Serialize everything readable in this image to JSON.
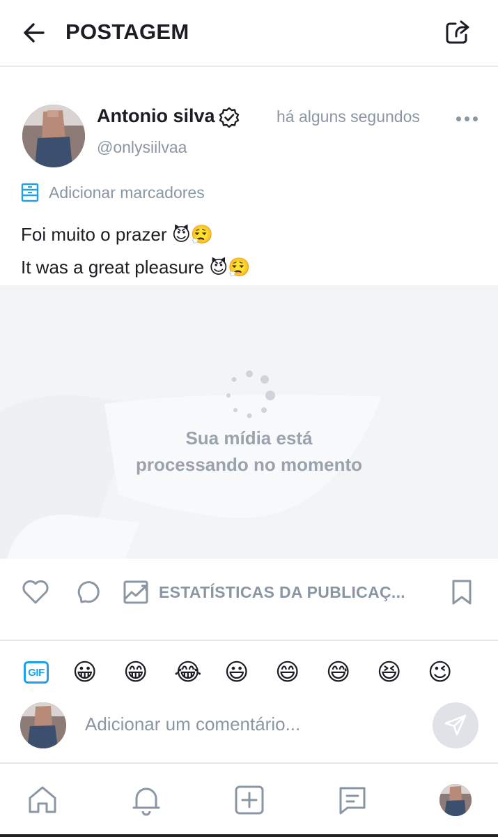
{
  "header": {
    "title": "POSTAGEM",
    "back_icon": "arrow-left-icon",
    "share_icon": "share-icon"
  },
  "post": {
    "author_name": "Antonio silva",
    "handle": "@onlysiilvaa",
    "time": "há alguns segundos",
    "bookmark_label": "Adicionar marcadores",
    "text_line1": "Foi muito o prazer",
    "text_line1_emoji": "😈😮‍💨",
    "text_line2": "It was a great pleasure",
    "text_line2_emoji": "😈😮‍💨"
  },
  "media": {
    "message_line1": "Sua mídia está",
    "message_line2": "processando no momento"
  },
  "actions": {
    "stats_label": "ESTATÍSTICAS DA PUBLICAÇ..."
  },
  "emoji_bar": {
    "gif_label": "GIF",
    "emojis": [
      "😀",
      "😁",
      "😂",
      "😃",
      "😄",
      "😅",
      "😆",
      "😉"
    ]
  },
  "comment": {
    "placeholder": "Adicionar um comentário..."
  },
  "colors": {
    "text_primary": "#1b1d22",
    "text_secondary": "#8a96a3",
    "accent_blue": "#1ea1e8",
    "divider": "#e6e8ec",
    "media_bg": "#f3f4f6"
  }
}
